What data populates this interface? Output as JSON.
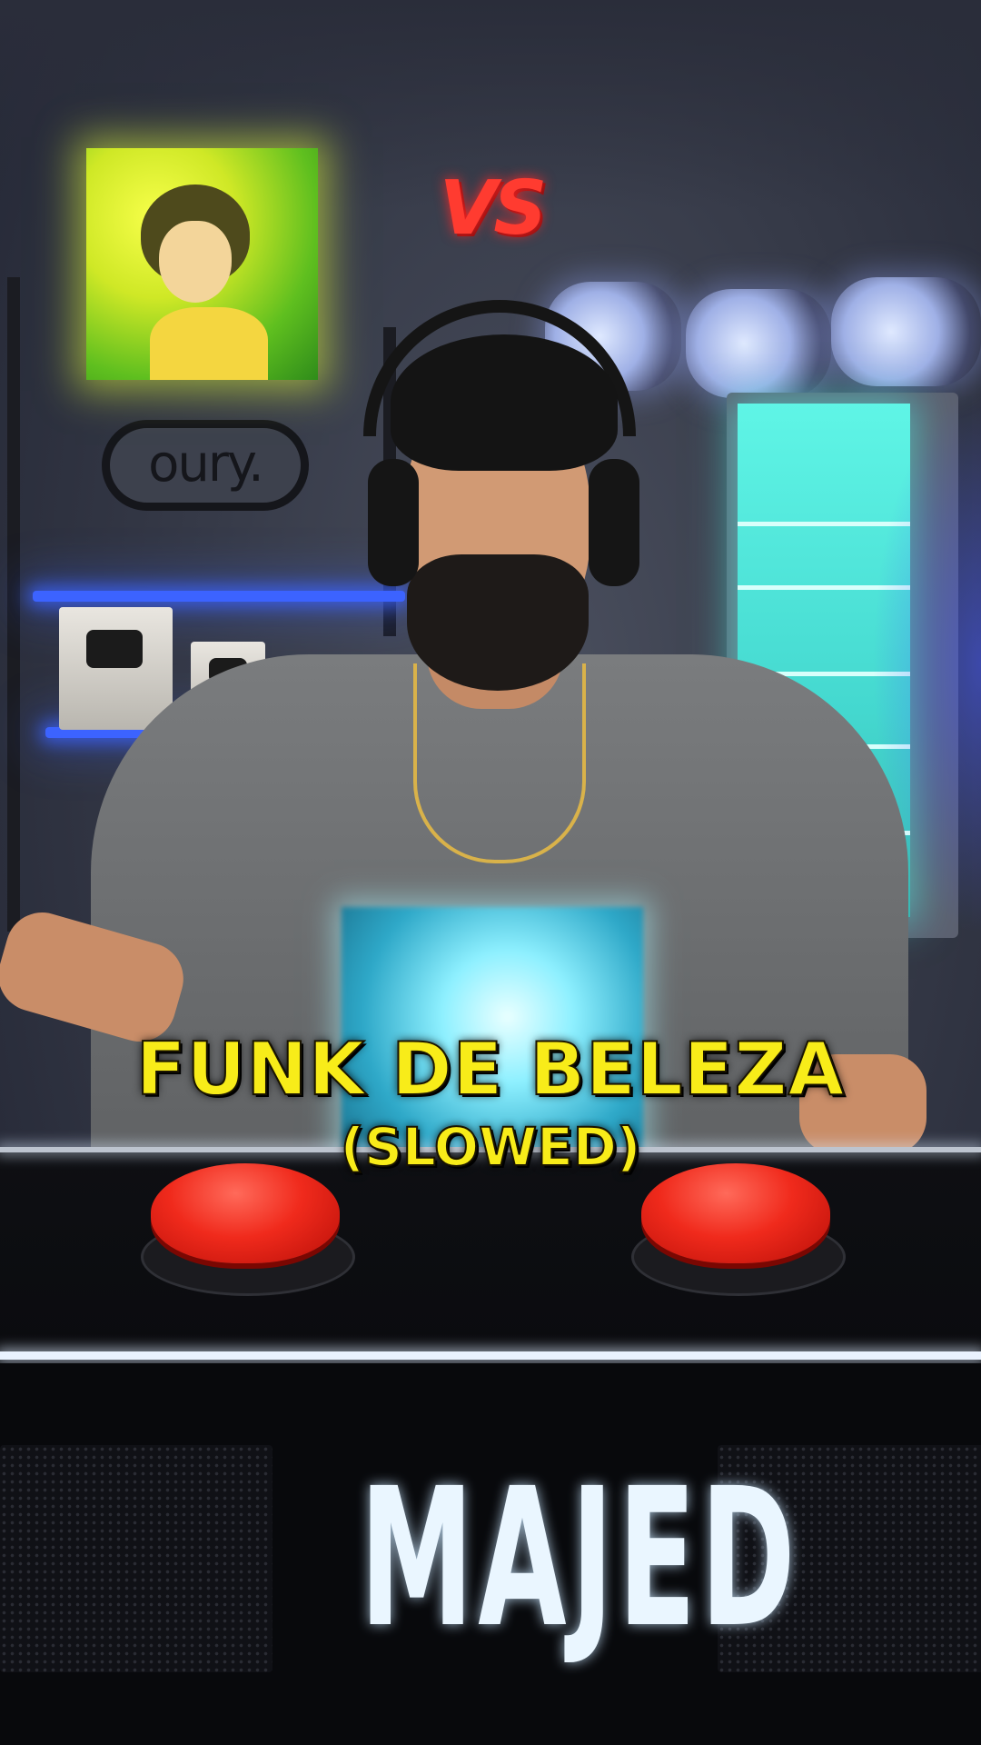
{
  "overlay": {
    "vs_label": "VS",
    "song_title": "FUNK DE BELEZA",
    "song_subtitle": "(SLOWED)"
  },
  "background": {
    "wall_sign": "oury."
  },
  "desk": {
    "brand_name": "MAJED"
  },
  "colors": {
    "caption": "#f8ec19",
    "vs": "#ff3b30",
    "neon_shelf": "#3c63ff",
    "fridge_glow": "#5ff5e6",
    "buzzer": "#f02a1c"
  }
}
